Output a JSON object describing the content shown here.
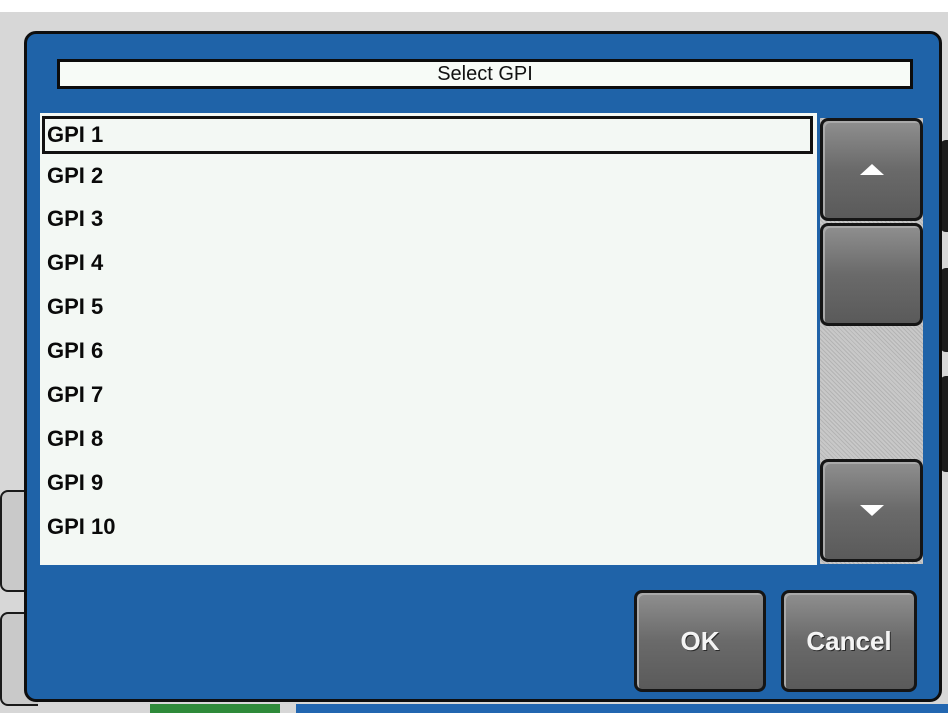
{
  "dialog": {
    "title": "Select GPI",
    "selected_index": 0,
    "items": [
      "GPI 1",
      "GPI 2",
      "GPI 3",
      "GPI 4",
      "GPI 5",
      "GPI 6",
      "GPI 7",
      "GPI 8",
      "GPI 9",
      "GPI 10"
    ],
    "ok_label": "OK",
    "cancel_label": "Cancel"
  },
  "icons": {
    "scroll_up": "triangle-up-icon",
    "scroll_down": "triangle-down-icon"
  },
  "colors": {
    "dialog_bg": "#1f63a8",
    "list_bg": "#f3f8f4",
    "button_bg": "#6a6a6a"
  }
}
